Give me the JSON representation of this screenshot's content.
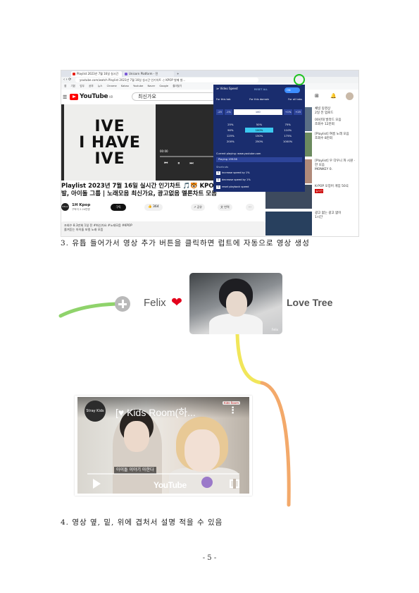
{
  "browser": {
    "tabs": [
      "Playlist 2023년 7월 16일 실시간",
      "Unicorn Platform - 전",
      "+"
    ],
    "url": "youtube.com/watch  Playlist 2023년 7월 16일 실시간 인기차트 ♫ KPOP 발매 발...",
    "bookmarks": [
      "앱",
      "기본",
      "업무",
      "공부",
      "뉴스",
      "Chrome",
      "Kakao",
      "Youtube",
      "Naver",
      "Google",
      "즐겨찾기"
    ]
  },
  "youtube": {
    "logo": "YouTube",
    "logo_sup": "KR",
    "search_value": "최신가요",
    "album_lines": [
      "IVE",
      "I HAVE",
      "IVE"
    ],
    "time": "00:00",
    "video_title": "Playlist 2023년 7월 16일 실시간 인기차트 🎵🐯 KPOP 발매 발",
    "video_title_2": "발, 아이돌 그룹 | 노래모음 최신가요, 광고없음 멜론차트 모음",
    "channel_avatar": "1Hour",
    "channel_name": "1H Kpop",
    "channel_subs": "구독자 2.24만명",
    "subscribe": "구독",
    "likes": "364",
    "share": "공유",
    "translate": "번역",
    "more": "···",
    "desc_line1": "조회수 8.3만회 1일 전 #최신가요 #노래모음 #KPOP",
    "desc_line2": "즐겨듣는 아이돌 보컬 노래 모음",
    "sidebar": [
      {
        "title": "채널 동영상",
        "meta": "2일 전 업로드"
      },
      {
        "title": "00년대 발라드 모음",
        "meta": "조회수 12만회"
      },
      {
        "title": "[Playlist] 여름 노래 모음",
        "meta": "조회수 8만회"
      },
      {
        "title": "[Playlist] 우 다우니 까 시원 · 한 모음",
        "meta": "MONKEY 0."
      },
      {
        "title": "K-POP 오징어 게임 50곡",
        "meta": "실시간"
      },
      {
        "title": "광고 없는 광고 없이",
        "meta": "1시간"
      }
    ],
    "live": "실시간"
  },
  "extension": {
    "title": "Video Speed",
    "reset": "RESET ALL",
    "toggle": "ON",
    "scopes": [
      "For this tab",
      "For this domain",
      "For all tabs"
    ],
    "controls": [
      "-25",
      "-1%",
      "100",
      "+1%",
      "+25"
    ],
    "speeds": [
      "25%",
      "50%",
      "75%",
      "90%",
      "100%",
      "110%",
      "125%",
      "150%",
      "175%",
      "200%",
      "250%",
      "1000%"
    ],
    "selected_speed": "100%",
    "current_label": "Current playing: www.youtube.com",
    "playing": "Playing   199:56",
    "shortcuts_label": "Shortcuts",
    "shortcuts": [
      {
        "key": "A",
        "text": "increase speed by 1%"
      },
      {
        "key": "D",
        "text": "decrease speed by 1%"
      },
      {
        "key": "S",
        "text": "reset playback speed"
      }
    ]
  },
  "caption_3": "3. 유튭 들어가서 영상 추가 버튼을 클릭하면 럽트에 자동으로 영상 생성",
  "tree": {
    "felix": "Felix",
    "heart": "❤",
    "love_tree": "Love Tree",
    "photo_mark": "Felix",
    "video_title": "[♥ Kids Room(하...",
    "video_logo": "Stray Kids",
    "video_badge": "Kids Room",
    "video_sub": "아이돌 이야기 아한다",
    "video_brand": "YouTube",
    "colors": {
      "green_branch": "#8fd36b",
      "yellow_branch": "#f1e65a",
      "orange_branch": "#f3a96a"
    }
  },
  "caption_4": "4. 영상 옆, 밑, 위에 겹처서 설명 적을 수 있음",
  "page_number": "- 5 -"
}
